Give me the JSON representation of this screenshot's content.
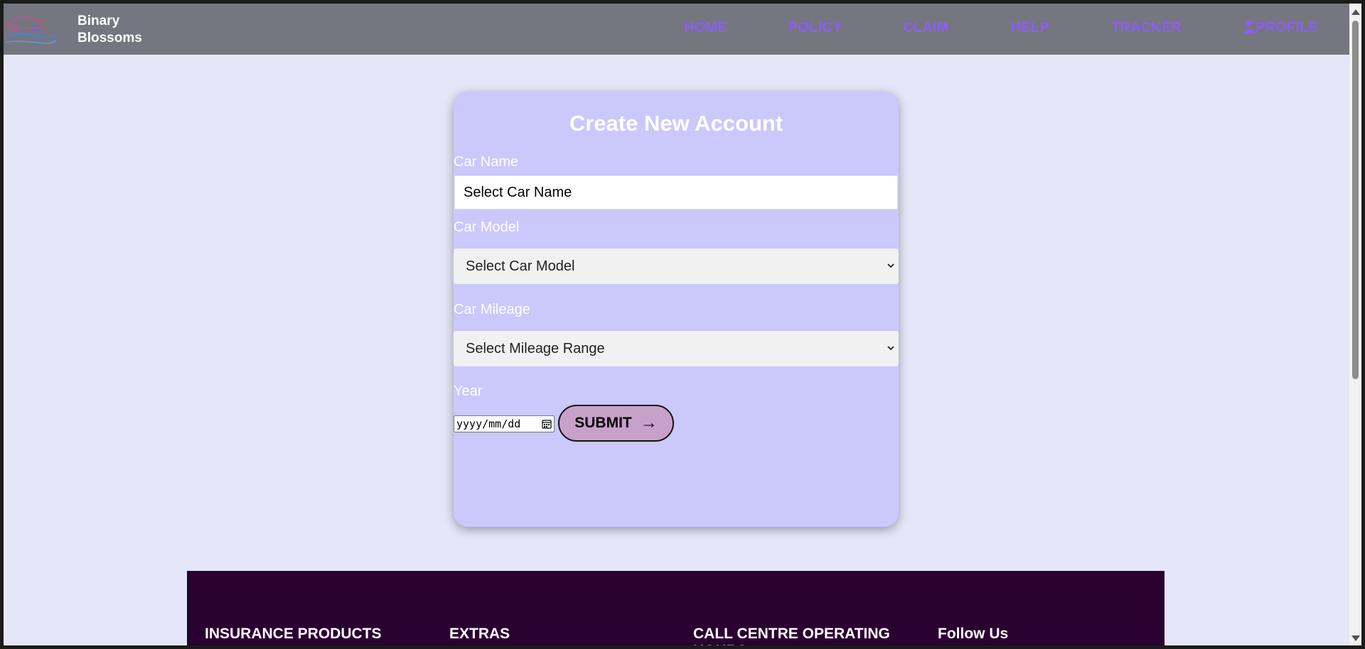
{
  "brand": {
    "line1": "Binary",
    "line2": "Blossoms"
  },
  "nav": {
    "home": "HOME",
    "policy": "POLICY",
    "claim": "CLAIM",
    "help": "HELP",
    "tracker": "TRACKER",
    "profile": "PROFILE"
  },
  "form": {
    "title": "Create New Account",
    "car_name_label": "Car Name",
    "car_name_value": "Select Car Name",
    "car_model_label": "Car Model",
    "car_model_value": "Select Car Model",
    "car_mileage_label": "Car Mileage",
    "car_mileage_value": "Select Mileage Range",
    "year_label": "Year",
    "date_placeholder": "yyyy/mm/dd",
    "submit_label": "SUBMIT",
    "submit_arrow": "→"
  },
  "footer": {
    "col1": "INSURANCE PRODUCTS",
    "col2": "EXTRAS",
    "col3": "CALL CENTRE OPERATING HOURS",
    "col4": "Follow Us"
  },
  "colors": {
    "navbar": "#75767f",
    "nav_link": "#8a5ff0",
    "page_bg": "#e5e6f8",
    "card_bg": "#cbc8fc",
    "submit_bg": "#c8a1cb",
    "footer_bg": "#2a0030"
  },
  "icons": {
    "logo": "car-hand-logo-icon",
    "profile": "person-icon",
    "select": "chevron-down-icon",
    "calendar": "calendar-icon"
  }
}
